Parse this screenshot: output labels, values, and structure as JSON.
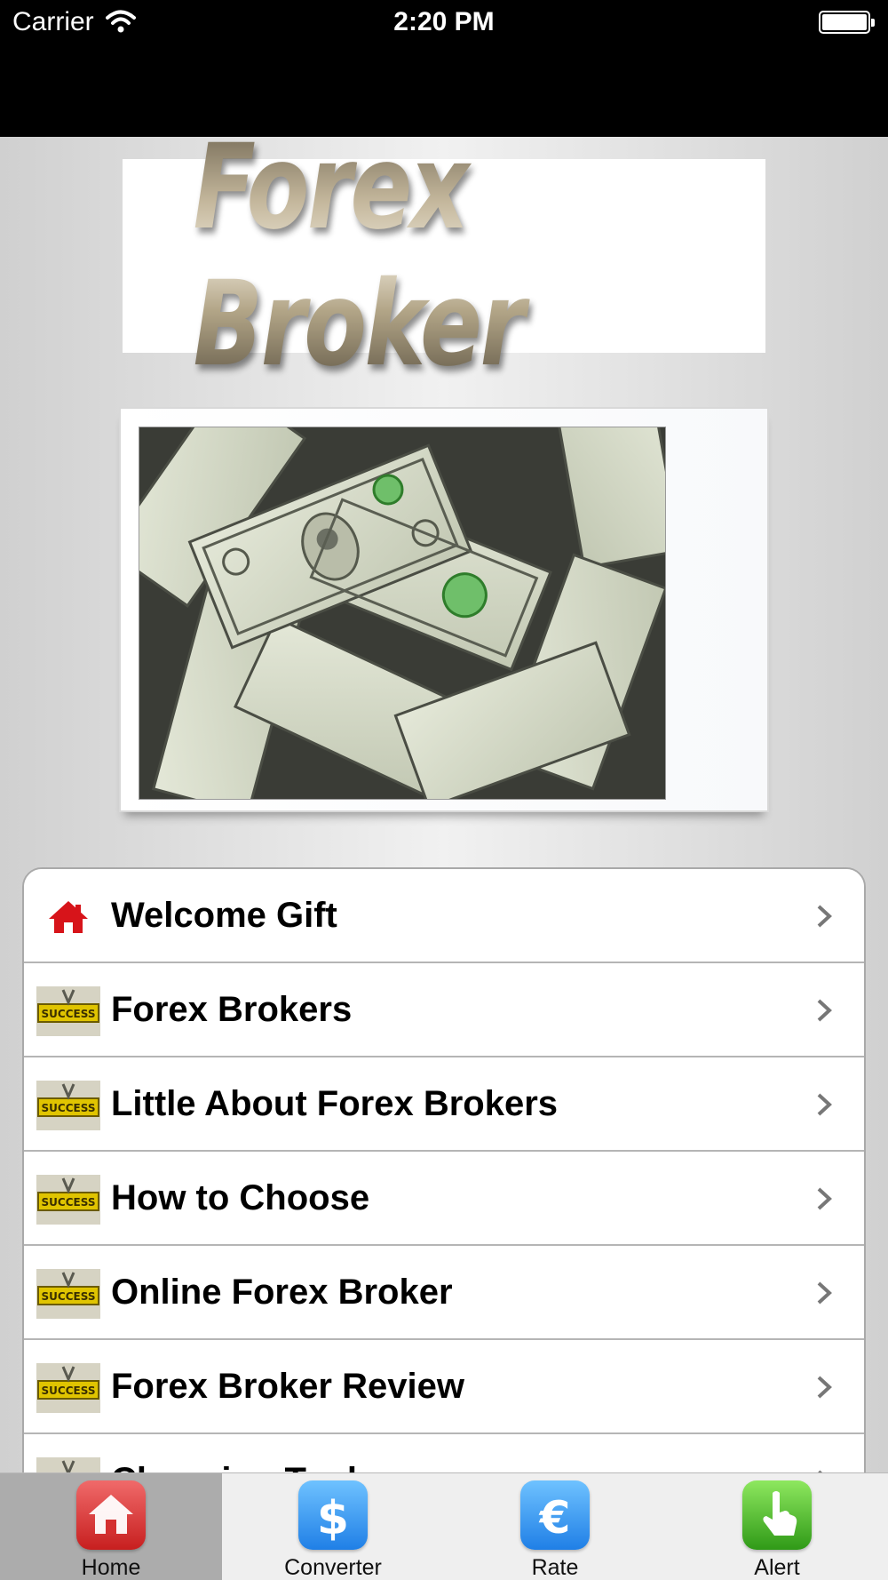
{
  "status_bar": {
    "carrier": "Carrier",
    "time": "2:20 PM"
  },
  "logo": {
    "text": "Forex Broker"
  },
  "menu": {
    "items": [
      {
        "label": "Welcome Gift",
        "icon": "home-icon"
      },
      {
        "label": "Forex Brokers",
        "icon": "success-icon"
      },
      {
        "label": "Little About Forex Brokers",
        "icon": "success-icon"
      },
      {
        "label": "How to Choose",
        "icon": "success-icon"
      },
      {
        "label": "Online Forex Broker",
        "icon": "success-icon"
      },
      {
        "label": "Forex Broker Review",
        "icon": "success-icon"
      },
      {
        "label": "Choosing Tools",
        "icon": "success-icon"
      }
    ]
  },
  "tabbar": {
    "tabs": [
      {
        "label": "Home",
        "icon": "house-icon",
        "active": true
      },
      {
        "label": "Converter",
        "icon": "dollar-icon",
        "active": false
      },
      {
        "label": "Rate",
        "icon": "euro-icon",
        "active": false
      },
      {
        "label": "Alert",
        "icon": "pointer-hand-icon",
        "active": false
      }
    ]
  },
  "colors": {
    "tab_active_bg": "#acacac",
    "home_icon_red": "#e13b3b",
    "converter_blue": "#2f8ff0",
    "alert_green": "#39a51c"
  }
}
